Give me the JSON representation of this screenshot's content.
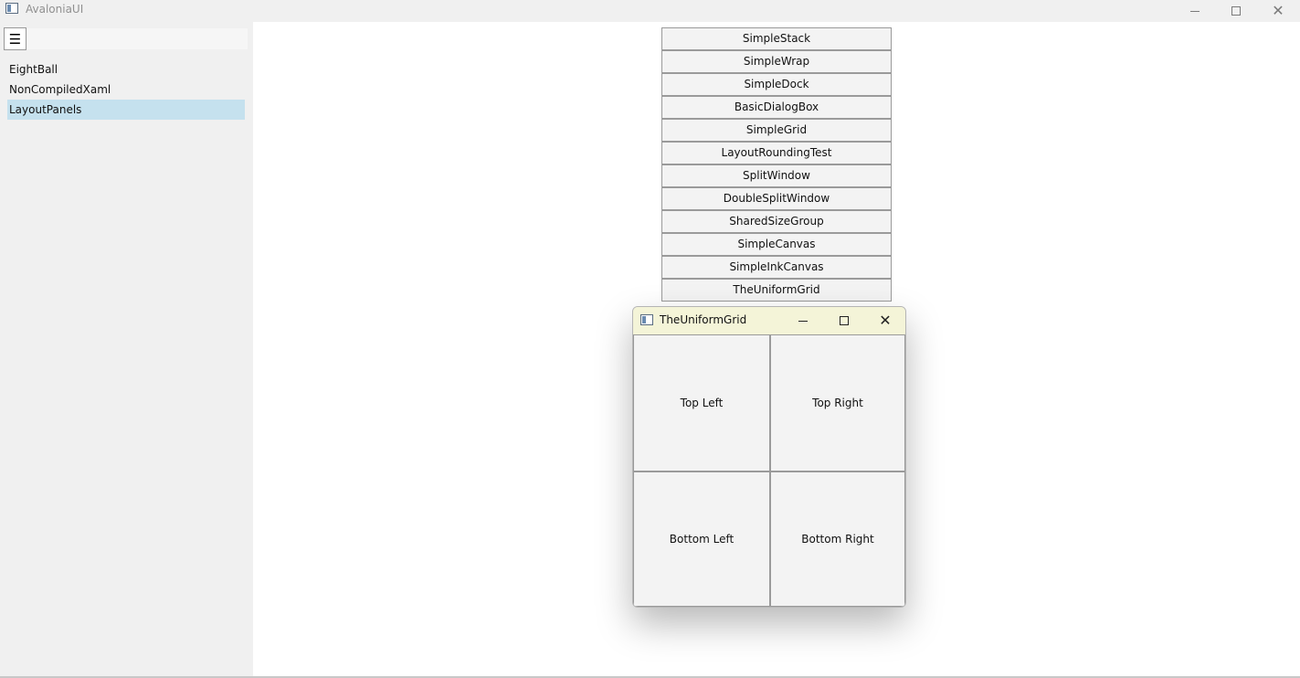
{
  "window": {
    "title": "AvaloniaUI"
  },
  "sidebar": {
    "menu_icon": "☰",
    "search_value": "",
    "items": [
      {
        "label": "EightBall",
        "selected": false
      },
      {
        "label": "NonCompiledXaml",
        "selected": false
      },
      {
        "label": "LayoutPanels",
        "selected": true
      }
    ],
    "selected_color": "#c5e1ee"
  },
  "content": {
    "buttons": [
      "SimpleStack",
      "SimpleWrap",
      "SimpleDock",
      "BasicDialogBox",
      "SimpleGrid",
      "LayoutRoundingTest",
      "SplitWindow",
      "DoubleSplitWindow",
      "SharedSizeGroup",
      "SimpleCanvas",
      "SimpleInkCanvas",
      "TheUniformGrid"
    ]
  },
  "dialog": {
    "title": "TheUniformGrid",
    "titlebar_color": "#f4f4d8",
    "cells": {
      "top_left": "Top Left",
      "top_right": "Top Right",
      "bottom_left": "Bottom Left",
      "bottom_right": "Bottom Right"
    }
  }
}
